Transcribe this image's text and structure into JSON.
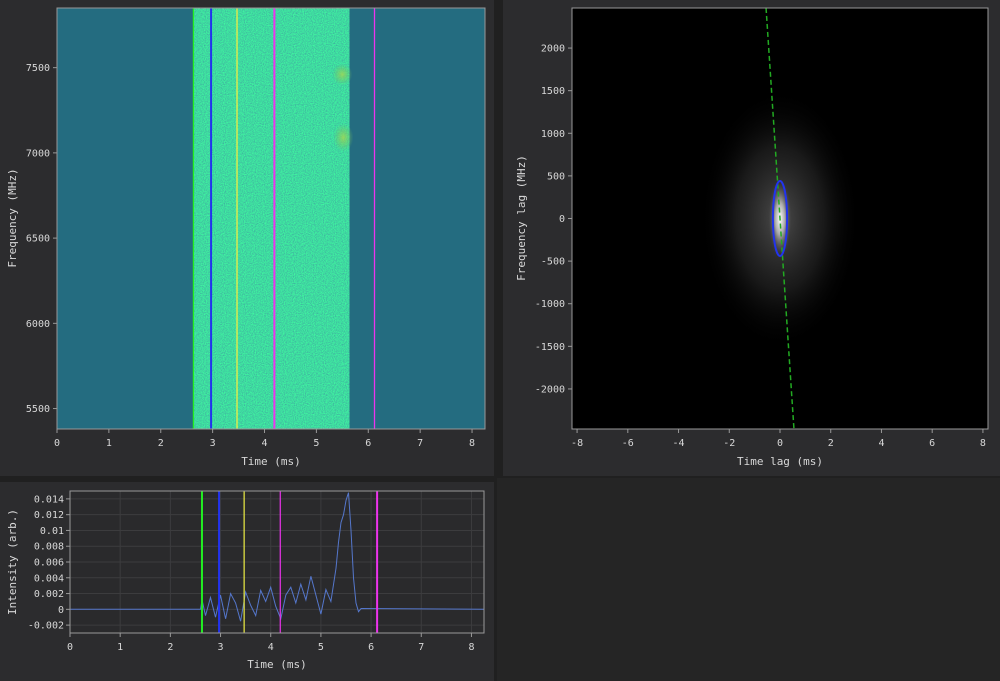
{
  "colors": {
    "green": "#22ee22",
    "blue": "#2233ee",
    "yellow": "#eeee44",
    "magenta": "#ee33ee",
    "profile_line": "#5577cc",
    "dyn_background": "#246c80",
    "ellipse": "#2233ee",
    "dashed_fit": "#22aa22"
  },
  "chart_data": [
    {
      "name_hint": "dynamic-spectrum",
      "type": "heatmap",
      "xlabel": "Time (ms)",
      "ylabel": "Frequency (MHz)",
      "xlim": [
        0,
        8.25
      ],
      "ylim": [
        5380,
        7850
      ],
      "xticks": [
        0,
        1,
        2,
        3,
        4,
        5,
        6,
        7,
        8
      ],
      "yticks": [
        5500,
        6000,
        6500,
        7000,
        7500
      ],
      "signal_region_ms": [
        2.63,
        5.63
      ],
      "bright_patches": [
        {
          "t": 5.52,
          "f_low": 7030,
          "f_high": 7150
        },
        {
          "t": 5.5,
          "f_low": 7420,
          "f_high": 7500
        }
      ],
      "vlines": [
        {
          "x": 2.63,
          "color": "green"
        },
        {
          "x": 2.97,
          "color": "blue"
        },
        {
          "x": 3.47,
          "color": "yellow"
        },
        {
          "x": 4.19,
          "color": "magenta"
        },
        {
          "x": 6.12,
          "color": "magenta"
        }
      ]
    },
    {
      "name_hint": "autocorrelation",
      "type": "heatmap",
      "xlabel": "Time lag (ms)",
      "ylabel": "Frequency lag (MHz)",
      "xlim": [
        -8.2,
        8.2
      ],
      "ylim": [
        -2470,
        2470
      ],
      "xticks": [
        -8,
        -6,
        -4,
        -2,
        0,
        2,
        4,
        6,
        8
      ],
      "yticks": [
        -2000,
        -1500,
        -1000,
        -500,
        0,
        500,
        1000,
        1500,
        2000
      ],
      "ellipse": {
        "cx": 0,
        "cy": 0,
        "rx": 0.28,
        "ry": 440
      },
      "fit_line": {
        "x1": -0.55,
        "y1": 2470,
        "x2": 0.55,
        "y2": -2470
      }
    },
    {
      "name_hint": "profile",
      "type": "line",
      "xlabel": "Time (ms)",
      "ylabel": "Intensity (arb.)",
      "xlim": [
        0,
        8.25
      ],
      "ylim": [
        -0.003,
        0.015
      ],
      "xticks": [
        0,
        1,
        2,
        3,
        4,
        5,
        6,
        7,
        8
      ],
      "yticks": [
        -0.002,
        0,
        0.002,
        0.004,
        0.006,
        0.008,
        0.01,
        0.012,
        0.014
      ],
      "ytick_labels": [
        "-0.002",
        "0",
        "0.002",
        "0.004",
        "0.006",
        "0.008",
        "0.01",
        "0.012",
        "0.014"
      ],
      "grid": true,
      "series": [
        {
          "x": [
            0,
            2.6,
            2.63,
            2.7,
            2.8,
            2.9,
            3.0,
            3.1,
            3.2,
            3.3,
            3.4,
            3.5,
            3.6,
            3.7,
            3.8,
            3.9,
            4.0,
            4.1,
            4.2,
            4.3,
            4.4,
            4.5,
            4.6,
            4.7,
            4.8,
            4.9,
            5.0,
            5.1,
            5.2,
            5.3,
            5.35,
            5.4,
            5.45,
            5.5,
            5.55,
            5.6,
            5.65,
            5.7,
            5.75,
            5.8,
            8.25
          ],
          "y": [
            0,
            0,
            0.0012,
            -0.0008,
            0.0015,
            -0.001,
            0.0018,
            -0.0012,
            0.002,
            0.0008,
            -0.0015,
            0.0022,
            0.0005,
            -0.0008,
            0.0024,
            0.001,
            0.0028,
            0.0004,
            -0.0012,
            0.0018,
            0.0028,
            0.0008,
            0.0032,
            0.0012,
            0.0042,
            0.0018,
            -0.0006,
            0.0025,
            0.001,
            0.0052,
            0.0085,
            0.011,
            0.012,
            0.0138,
            0.0148,
            0.01,
            0.004,
            0.0008,
            -0.0003,
            0.0001,
            0
          ]
        }
      ],
      "vlines": [
        {
          "x": 2.63,
          "color": "green"
        },
        {
          "x": 2.97,
          "color": "blue"
        },
        {
          "x": 3.47,
          "color": "yellow"
        },
        {
          "x": 4.19,
          "color": "magenta"
        },
        {
          "x": 6.12,
          "color": "magenta"
        }
      ]
    }
  ]
}
